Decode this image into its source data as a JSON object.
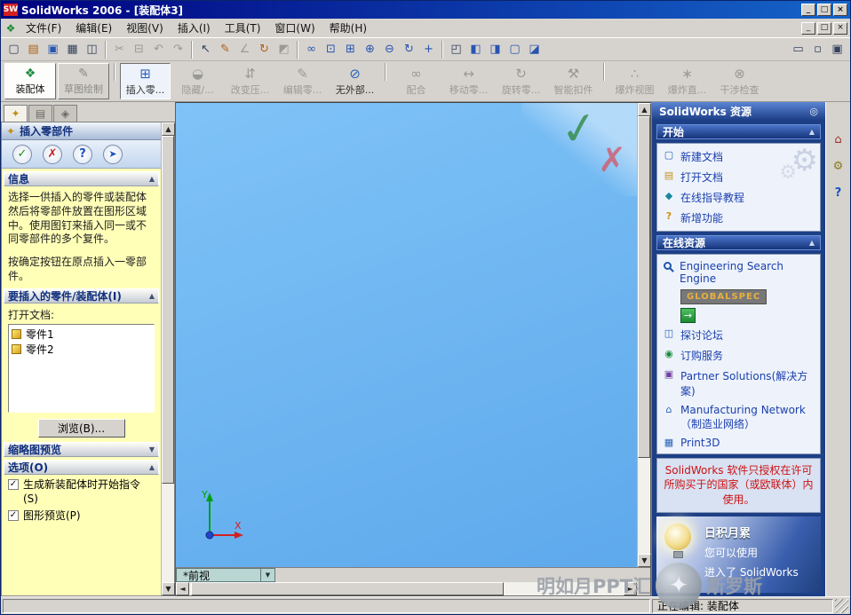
{
  "titlebar": {
    "logo": "SW",
    "title": "SolidWorks 2006 - [装配体3]"
  },
  "glyphs": {
    "min": "_",
    "max": "□",
    "close": "×",
    "up": "▲",
    "down": "▼",
    "left": "◄",
    "right": "►",
    "doc": "❖",
    "pin_header": "◎",
    "go": "→"
  },
  "menubar": {
    "items": [
      "文件(F)",
      "编辑(E)",
      "视图(V)",
      "插入(I)",
      "工具(T)",
      "窗口(W)",
      "帮助(H)"
    ]
  },
  "toolbar1": [
    "▢",
    "▤",
    "▣",
    "▦",
    "◫",
    "✂",
    "⊟",
    "↶",
    "↷",
    "↖",
    "✎",
    "∠",
    "↻",
    "◩",
    "∞",
    "⊡",
    "⊞",
    "⊕",
    "⊖",
    "↻",
    "+",
    "◰",
    "◧",
    "◨",
    "▢",
    "◪",
    "▭",
    "▫",
    "▣"
  ],
  "assembly_toolbar": {
    "tabs": [
      {
        "label": "装配体",
        "glyph": "❖"
      },
      {
        "label": "草图绘制",
        "glyph": "✎"
      }
    ],
    "buttons": [
      {
        "label": "插入零...",
        "glyph": "⊞"
      },
      {
        "label": "隐藏/...",
        "glyph": "◒"
      },
      {
        "label": "改变压...",
        "glyph": "⇵"
      },
      {
        "label": "编辑零...",
        "glyph": "✎"
      },
      {
        "label": "无外部...",
        "glyph": "⊘"
      },
      {
        "label": "配合",
        "glyph": "∞"
      },
      {
        "label": "移动零...",
        "glyph": "↔"
      },
      {
        "label": "旋转零...",
        "glyph": "↻"
      },
      {
        "label": "智能扣件",
        "glyph": "⚒"
      },
      {
        "label": "爆炸视图",
        "glyph": "∴"
      },
      {
        "label": "爆炸直...",
        "glyph": "∗"
      },
      {
        "label": "干涉检查",
        "glyph": "⊗"
      }
    ]
  },
  "pm": {
    "tab_glyphs": [
      "✦",
      "▤",
      "◈"
    ],
    "title": "插入零部件",
    "buttons": {
      "ok": "✓",
      "cancel": "✗",
      "help": "?",
      "pin": "➤"
    },
    "info_header": "信息",
    "message_p1": "选择一供插入的零件或装配体然后将零部件放置在图形区域中。使用图钉来插入同一或不同零部件的多个复件。",
    "message_p2": "按确定按钮在原点插入一零部件。",
    "insert_header": "要插入的零件/装配体(I)",
    "open_docs_label": "打开文档:",
    "documents": [
      "零件1",
      "零件2"
    ],
    "browse_label": "浏览(B)...",
    "thumbnail_header": "缩略图预览",
    "options_header": "选项(O)",
    "options": [
      "生成新装配体时开始指令(S)",
      "图形预览(P)"
    ],
    "check": "✓"
  },
  "viewport": {
    "check": "✓",
    "cross": "✗",
    "axis_x": "X",
    "axis_y": "Y",
    "config_tab": "*前视"
  },
  "task_pane": {
    "title": "SolidWorks 资源",
    "start": {
      "header": "开始",
      "glyphs": [
        "▢",
        "▤",
        "◆",
        "?"
      ],
      "items": [
        "新建文档",
        "打开文档",
        "在线指导教程",
        "新增功能"
      ]
    },
    "online": {
      "header": "在线资源",
      "search_engine": "Engineering Search Engine",
      "globalspec": "GLOBALSPEC",
      "link_glyphs": [
        "◫",
        "◉",
        "▣",
        "⌂",
        "▦"
      ],
      "links": [
        "探讨论坛",
        "订购服务",
        "Partner Solutions(解决方案)",
        "Manufacturing Network（制造业网络）",
        "Print3D"
      ]
    },
    "license_notice": "SolidWorks 软件只授权在许可所购买于的国家（或欧联体）内使用。",
    "tip": {
      "header": "日积月累",
      "line1": "您可以使用",
      "line2": "进入了 SolidWorks"
    }
  },
  "side_strip": {
    "home": "⌂",
    "gears": "⚙",
    "help": "?"
  },
  "statusbar": {
    "editing": "正在编辑: 装配体"
  },
  "watermark": {
    "left": "明如月PPT汇",
    "badge": "✦",
    "right": "斯罗斯"
  }
}
